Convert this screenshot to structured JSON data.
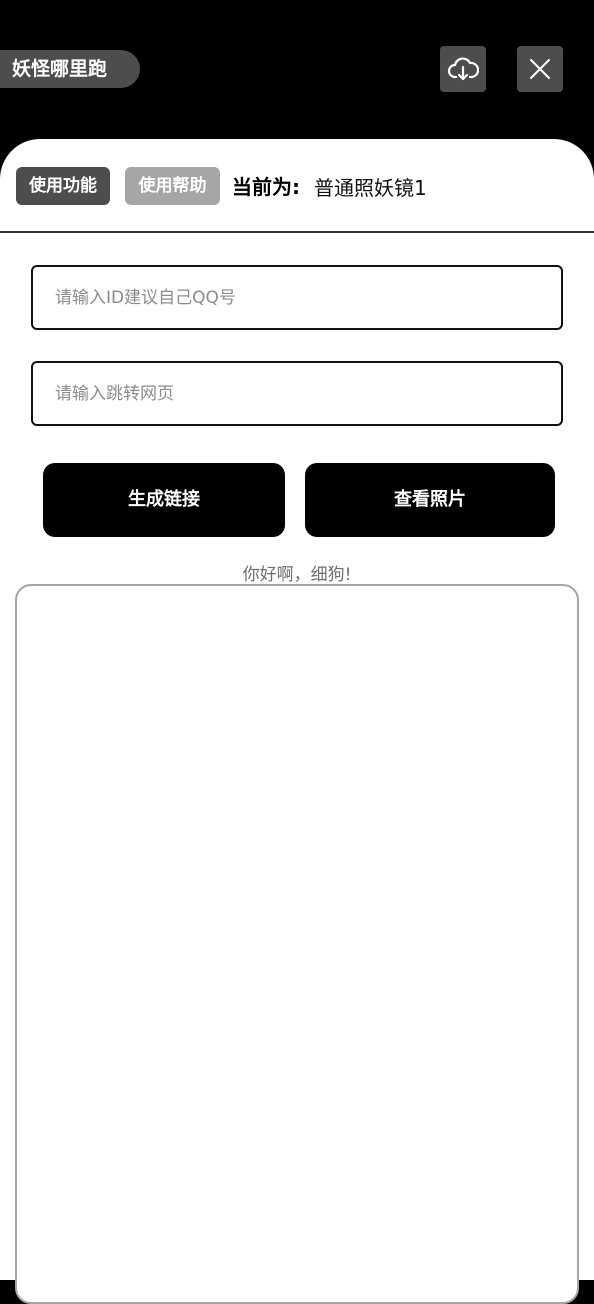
{
  "header": {
    "app_title": "妖怪哪里跑",
    "cloud_icon": "cloud-download-icon",
    "close_icon": "close-icon"
  },
  "tabs": [
    {
      "label": "使用功能",
      "active": true
    },
    {
      "label": "使用帮助",
      "active": false
    }
  ],
  "current": {
    "label": "当前为:",
    "value": "普通照妖镜1"
  },
  "form": {
    "id_placeholder": "请输入ID建议自己QQ号",
    "id_value": "",
    "url_placeholder": "请输入跳转网页",
    "url_value": ""
  },
  "actions": {
    "generate_label": "生成链接",
    "view_label": "查看照片"
  },
  "greeting": "你好啊，细狗!",
  "colors": {
    "background": "#000000",
    "panel": "#ffffff",
    "tab_active": "#4d4d4d",
    "tab_inactive": "#a6a6a6",
    "button": "#000000"
  }
}
